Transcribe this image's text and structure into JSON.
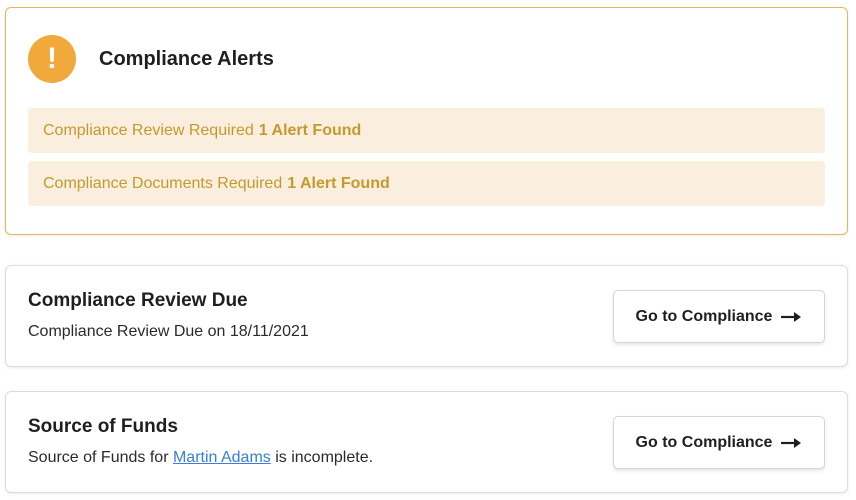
{
  "alerts": {
    "title": "Compliance Alerts",
    "icon": "exclamation-icon",
    "icon_glyph": "!",
    "accent_color": "#f2a93b",
    "items": [
      {
        "label": "Compliance Review Required",
        "count": "1 Alert Found"
      },
      {
        "label": "Compliance Documents Required",
        "count": "1 Alert Found"
      }
    ]
  },
  "cards": [
    {
      "title": "Compliance Review Due",
      "description": "Compliance Review Due on 18/11/2021",
      "button_label": "Go to Compliance"
    },
    {
      "title": "Source of Funds",
      "description_prefix": "Source of Funds for ",
      "description_link": "Martin Adams",
      "description_suffix": " is incomplete.",
      "button_label": "Go to Compliance"
    }
  ],
  "colors": {
    "alert_text": "#c49a2c",
    "alert_bg": "#faefdf",
    "link": "#3b7dd8"
  }
}
